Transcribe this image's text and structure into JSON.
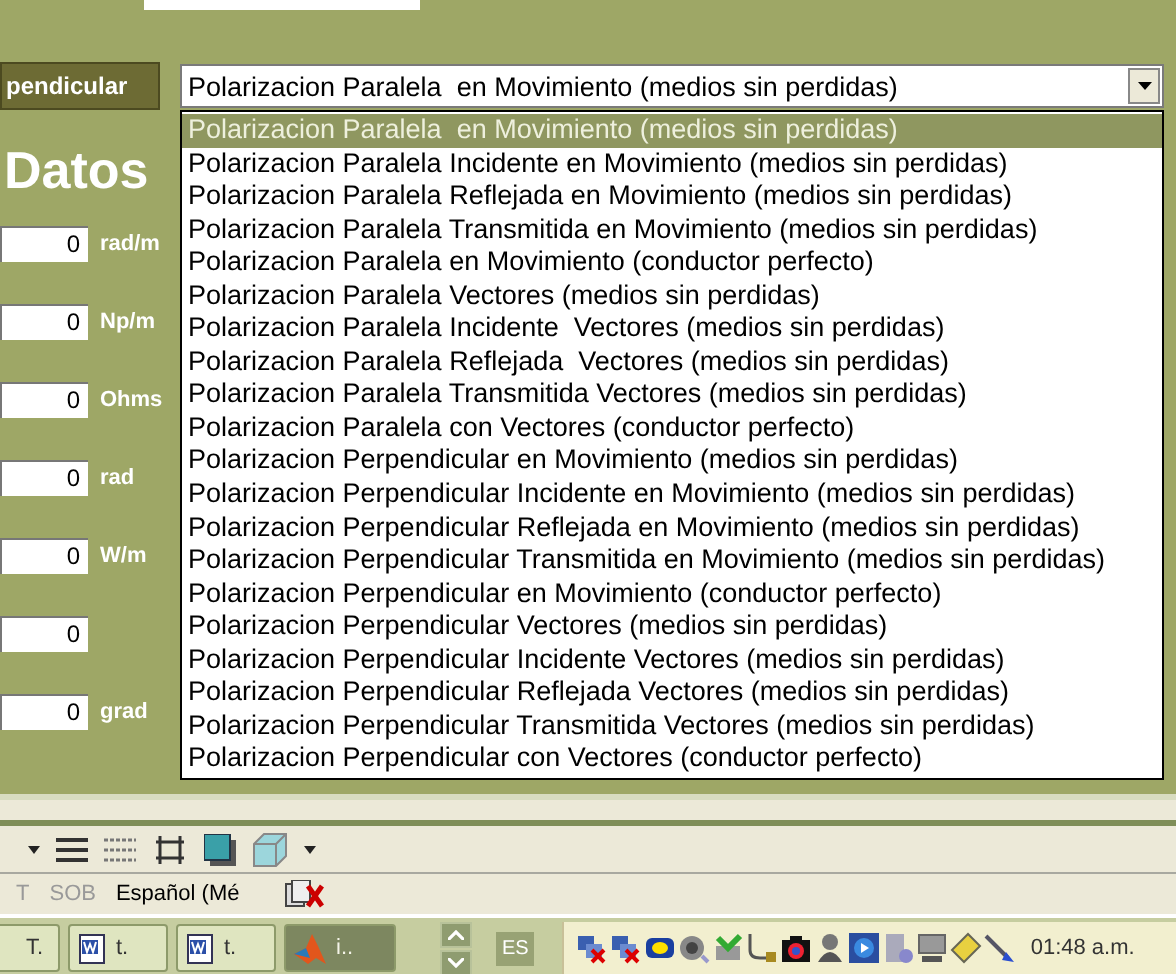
{
  "mode_button": {
    "label": "pendicular"
  },
  "combo": {
    "value": "Polarizacion Paralela  en Movimiento (medios sin perdidas)",
    "expanded": true,
    "options": [
      {
        "label": "Polarizacion Paralela  en Movimiento (medios sin perdidas)",
        "selected": true
      },
      {
        "label": "Polarizacion Paralela Incidente en Movimiento (medios sin perdidas)",
        "selected": false
      },
      {
        "label": "Polarizacion Paralela Reflejada en Movimiento (medios sin perdidas)",
        "selected": false
      },
      {
        "label": "Polarizacion Paralela Transmitida en Movimiento (medios sin perdidas)",
        "selected": false
      },
      {
        "label": "Polarizacion Paralela en Movimiento (conductor perfecto)",
        "selected": false
      },
      {
        "label": "Polarizacion Paralela Vectores (medios sin perdidas)",
        "selected": false
      },
      {
        "label": "Polarizacion Paralela Incidente  Vectores (medios sin perdidas)",
        "selected": false
      },
      {
        "label": "Polarizacion Paralela Reflejada  Vectores (medios sin perdidas)",
        "selected": false
      },
      {
        "label": "Polarizacion Paralela Transmitida Vectores (medios sin perdidas)",
        "selected": false
      },
      {
        "label": "Polarizacion Paralela con Vectores (conductor perfecto)",
        "selected": false
      },
      {
        "label": "Polarizacion Perpendicular en Movimiento (medios sin perdidas)",
        "selected": false
      },
      {
        "label": "Polarizacion Perpendicular Incidente en Movimiento (medios sin perdidas)",
        "selected": false
      },
      {
        "label": "Polarizacion Perpendicular Reflejada en Movimiento (medios sin perdidas)",
        "selected": false
      },
      {
        "label": "Polarizacion Perpendicular Transmitida en Movimiento (medios sin perdidas)",
        "selected": false
      },
      {
        "label": "Polarizacion Perpendicular en Movimiento (conductor perfecto)",
        "selected": false
      },
      {
        "label": "Polarizacion Perpendicular Vectores (medios sin perdidas)",
        "selected": false
      },
      {
        "label": "Polarizacion Perpendicular Incidente Vectores (medios sin perdidas)",
        "selected": false
      },
      {
        "label": "Polarizacion Perpendicular Reflejada Vectores (medios sin perdidas)",
        "selected": false
      },
      {
        "label": "Polarizacion Perpendicular Transmitida Vectores (medios sin perdidas)",
        "selected": false
      },
      {
        "label": "Polarizacion Perpendicular con Vectores (conductor perfecto)",
        "selected": false
      }
    ]
  },
  "heading": "Datos",
  "fields": [
    {
      "value": "0",
      "unit": "rad/m"
    },
    {
      "value": "0",
      "unit": "Np/m"
    },
    {
      "value": "0",
      "unit": "Ohms"
    },
    {
      "value": "0",
      "unit": "rad"
    },
    {
      "value": "0",
      "unit": "W/m"
    },
    {
      "value": "0"
    },
    {
      "value": "0",
      "unit": "grad"
    }
  ],
  "status_bar": [
    {
      "text": "T",
      "disabled": true
    },
    {
      "text": "SOB",
      "disabled": true
    },
    {
      "text": "Español (Mé",
      "disabled": false
    }
  ],
  "taskbar": {
    "buttons": [
      {
        "label": "T.",
        "kind": "plain",
        "selected": false
      },
      {
        "label": "t.",
        "kind": "document",
        "selected": false
      },
      {
        "label": "t.",
        "kind": "document",
        "selected": false
      },
      {
        "label": "i..",
        "kind": "app",
        "selected": true
      }
    ],
    "language": "ES",
    "clock": "01:48 a.m."
  }
}
